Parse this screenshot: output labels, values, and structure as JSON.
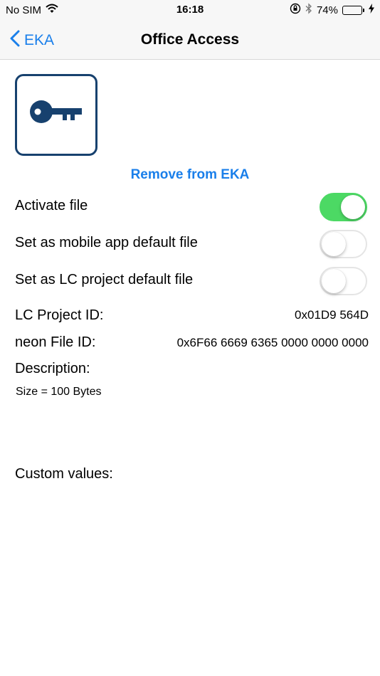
{
  "status_bar": {
    "carrier": "No SIM",
    "time": "16:18",
    "battery_percent": "74%",
    "battery_level": 0.74,
    "icons": [
      "wifi-icon",
      "orientation-lock-icon",
      "bluetooth-icon",
      "charging-bolt-icon"
    ]
  },
  "nav": {
    "back_label": "EKA",
    "title": "Office Access"
  },
  "file": {
    "icon": "key-icon",
    "remove_label": "Remove from EKA"
  },
  "settings": [
    {
      "label": "Activate file",
      "on": true
    },
    {
      "label": "Set as mobile app default file",
      "on": false
    },
    {
      "label": "Set as LC project default file",
      "on": false
    }
  ],
  "details": {
    "lc_project_id_label": "LC Project ID:",
    "lc_project_id_value": "0x01D9 564D",
    "neon_file_id_label": "neon File ID:",
    "neon_file_id_value": "0x6F66 6669 6365 0000 0000 0000",
    "description_label": "Description:",
    "description_value": "Size = 100 Bytes",
    "custom_values_label": "Custom values:"
  },
  "colors": {
    "accent": "#1a7fea",
    "toggle_on": "#4cd964",
    "key_tile": "#17416e"
  }
}
